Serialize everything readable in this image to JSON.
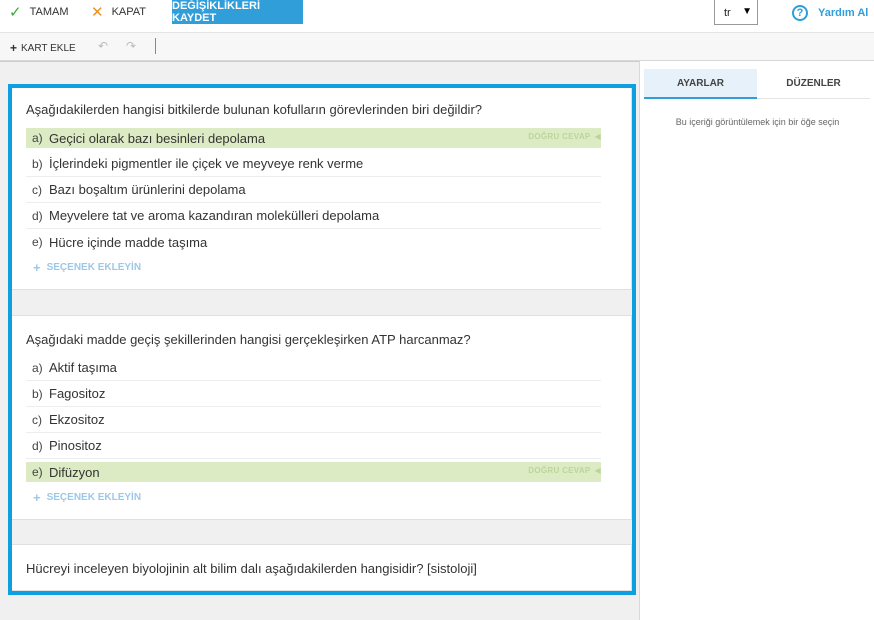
{
  "toolbar": {
    "ok_label": "TAMAM",
    "close_label": "KAPAT",
    "save_label": "DEĞİŞİKLİKLERİ KAYDET",
    "language": "tr",
    "help_label": "Yardım Al"
  },
  "toolbar2": {
    "add_card_label": "KART EKLE"
  },
  "questions": [
    {
      "text": "Aşağıdakilerden hangisi bitkilerde bulunan kofulların görevlerinden biri değildir?",
      "options": [
        {
          "letter": "a)",
          "text": "Geçici olarak bazı besinleri depolama",
          "correct": true
        },
        {
          "letter": "b)",
          "text": "İçlerindeki pigmentler ile çiçek ve meyveye renk verme",
          "correct": false
        },
        {
          "letter": "c)",
          "text": "Bazı boşaltım ürünlerini depolama",
          "correct": false
        },
        {
          "letter": "d)",
          "text": "Meyvelere tat ve aroma kazandıran molekülleri depolama",
          "correct": false
        },
        {
          "letter": "e)",
          "text": "Hücre içinde madde taşıma",
          "correct": false
        }
      ],
      "add_option_label": "SEÇENEK EKLEYİN"
    },
    {
      "text": "Aşağıdaki madde geçiş şekillerinden hangisi gerçekleşirken ATP harcanmaz?",
      "options": [
        {
          "letter": "a)",
          "text": "Aktif taşıma",
          "correct": false
        },
        {
          "letter": "b)",
          "text": "Fagositoz",
          "correct": false
        },
        {
          "letter": "c)",
          "text": "Ekzositoz",
          "correct": false
        },
        {
          "letter": "d)",
          "text": "Pinositoz",
          "correct": false
        },
        {
          "letter": "e)",
          "text": "Difüzyon",
          "correct": true
        }
      ],
      "add_option_label": "SEÇENEK EKLEYİN"
    },
    {
      "text": "Hücreyi inceleyen biyolojinin alt bilim dalı aşağıdakilerden hangisidir? [sistoloji]"
    }
  ],
  "correct_answer_label": "DOĞRU CEVAP",
  "panel": {
    "tabs": [
      "AYARLAR",
      "DÜZENLER"
    ],
    "active_tab": 0,
    "message": "Bu içeriği görüntülemek için bir öğe seçin"
  },
  "colors": {
    "accent": "#2f9ed9",
    "selection": "#0e9fe3",
    "correct_bg": "#dcebc3"
  }
}
